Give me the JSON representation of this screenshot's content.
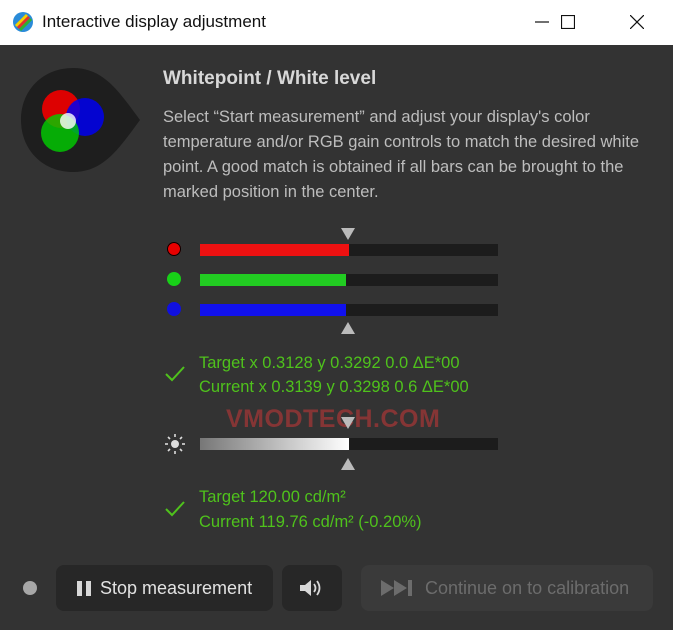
{
  "window": {
    "title": "Interactive display adjustment"
  },
  "heading": "Whitepoint / White level",
  "description": "Select “Start measurement” and adjust your display's color temperature and/or RGB gain controls to match the desired white point. A good match is obtained if all bars can be brought to the marked position in the center.",
  "rgb_bars": [
    {
      "channel": "red",
      "color": "#ee1111",
      "level": 0.5
    },
    {
      "channel": "green",
      "color": "#22cc22",
      "level": 0.49
    },
    {
      "channel": "blue",
      "color": "#1111ee",
      "level": 0.49
    }
  ],
  "chromaticity": {
    "target": "Target x 0.3128 y 0.3292 0.0 ΔE*00",
    "current": "Current x 0.3139 y 0.3298 0.6 ΔE*00"
  },
  "luminance_bar": {
    "level": 0.5
  },
  "luminance": {
    "target": "Target 120.00 cd/m²",
    "current": "Current 119.76 cd/m² (-0.20%)"
  },
  "watermark": "VMODTECH.COM",
  "buttons": {
    "stop": "Stop measurement",
    "continue": "Continue on to calibration"
  },
  "colors": {
    "accent_green": "#4fc21c",
    "background": "#333333"
  }
}
